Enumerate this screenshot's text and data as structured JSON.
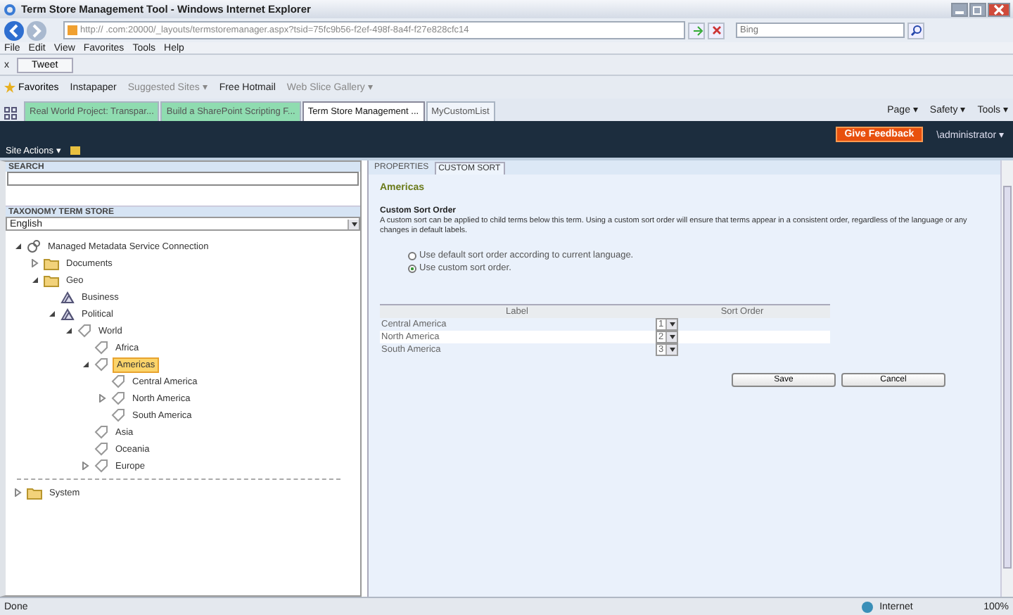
{
  "window": {
    "title": "Term Store Management Tool - Windows Internet Explorer"
  },
  "address_bar": {
    "url": "http://            .com:20000/_layouts/termstoremanager.aspx?tsid=75fc9b56-f2ef-498f-8a4f-f27e828cfc14",
    "search_placeholder": "Bing"
  },
  "menu": [
    "File",
    "Edit",
    "View",
    "Favorites",
    "Tools",
    "Help"
  ],
  "toolbar_tweet": {
    "close": "x",
    "button": "Tweet"
  },
  "favorites_bar": {
    "favorites": "Favorites",
    "links": [
      "Instapaper",
      "Suggested Sites ▾",
      "Free Hotmail",
      "Web Slice Gallery ▾"
    ]
  },
  "browser_tabs": [
    {
      "label": "Real World Project: Transpar...",
      "selected": false,
      "color": "#8fdcb0"
    },
    {
      "label": "Build a SharePoint Scripting F...",
      "selected": false,
      "color": "#8fdcb0"
    },
    {
      "label": "Term Store Management ...",
      "selected": true,
      "color": "#ffffff"
    },
    {
      "label": "MyCustomList",
      "selected": false,
      "color": "#f0f4fa"
    }
  ],
  "command_bar": [
    "Page ▾",
    "Safety ▾",
    "Tools ▾"
  ],
  "ribbon": {
    "site_actions": "Site Actions ▾",
    "feedback": "Give Feedback",
    "user": "\\administrator ▾"
  },
  "left_panel": {
    "search_title": "SEARCH",
    "store_title": "TAXONOMY TERM STORE",
    "language": "English",
    "tree": [
      {
        "label": "Managed Metadata Service Connection",
        "kind": "service",
        "expanded": true,
        "selected": false,
        "children": [
          {
            "label": "Documents",
            "kind": "group",
            "expanded": false,
            "selected": false
          },
          {
            "label": "Geo",
            "kind": "group",
            "expanded": true,
            "selected": false,
            "children": [
              {
                "label": "Business",
                "kind": "termset",
                "selected": false
              },
              {
                "label": "Political",
                "kind": "termset",
                "expanded": true,
                "selected": false,
                "children": [
                  {
                    "label": "World",
                    "kind": "term",
                    "expanded": true,
                    "selected": false,
                    "children": [
                      {
                        "label": "Africa",
                        "kind": "term",
                        "selected": false
                      },
                      {
                        "label": "Americas",
                        "kind": "term",
                        "expanded": true,
                        "selected": true,
                        "children": [
                          {
                            "label": "Central America",
                            "kind": "term",
                            "selected": false
                          },
                          {
                            "label": "North America",
                            "kind": "term",
                            "expanded": false,
                            "selected": false
                          },
                          {
                            "label": "South America",
                            "kind": "term",
                            "selected": false
                          }
                        ]
                      },
                      {
                        "label": "Asia",
                        "kind": "term",
                        "selected": false
                      },
                      {
                        "label": "Oceania",
                        "kind": "term",
                        "selected": false
                      },
                      {
                        "label": "Europe",
                        "kind": "term",
                        "expanded": false,
                        "selected": false
                      }
                    ]
                  }
                ]
              }
            ]
          }
        ]
      }
    ],
    "system": {
      "label": "System",
      "kind": "group",
      "expanded": false,
      "selected": false
    }
  },
  "right_panel": {
    "tabs": [
      {
        "label": "PROPERTIES",
        "selected": false
      },
      {
        "label": "CUSTOM SORT",
        "selected": true
      }
    ],
    "term": "Americas",
    "section_title": "Custom Sort Order",
    "description": "A custom sort can be applied to child terms below this term. Using a custom sort order will ensure that terms appear in a consistent order, regardless of the language or any changes in default labels.",
    "options": [
      {
        "label": "Use default sort order according to current language.",
        "selected": false
      },
      {
        "label": "Use custom sort order.",
        "selected": true
      }
    ],
    "columns": [
      "Label",
      "Sort Order"
    ],
    "rows": [
      {
        "label": "Central America",
        "order": "1"
      },
      {
        "label": "North America",
        "order": "2"
      },
      {
        "label": "South America",
        "order": "3"
      }
    ],
    "buttons": [
      "Save",
      "Cancel"
    ]
  },
  "status_bar": {
    "status": "Done",
    "zone": "Internet",
    "zoom": "100%"
  }
}
